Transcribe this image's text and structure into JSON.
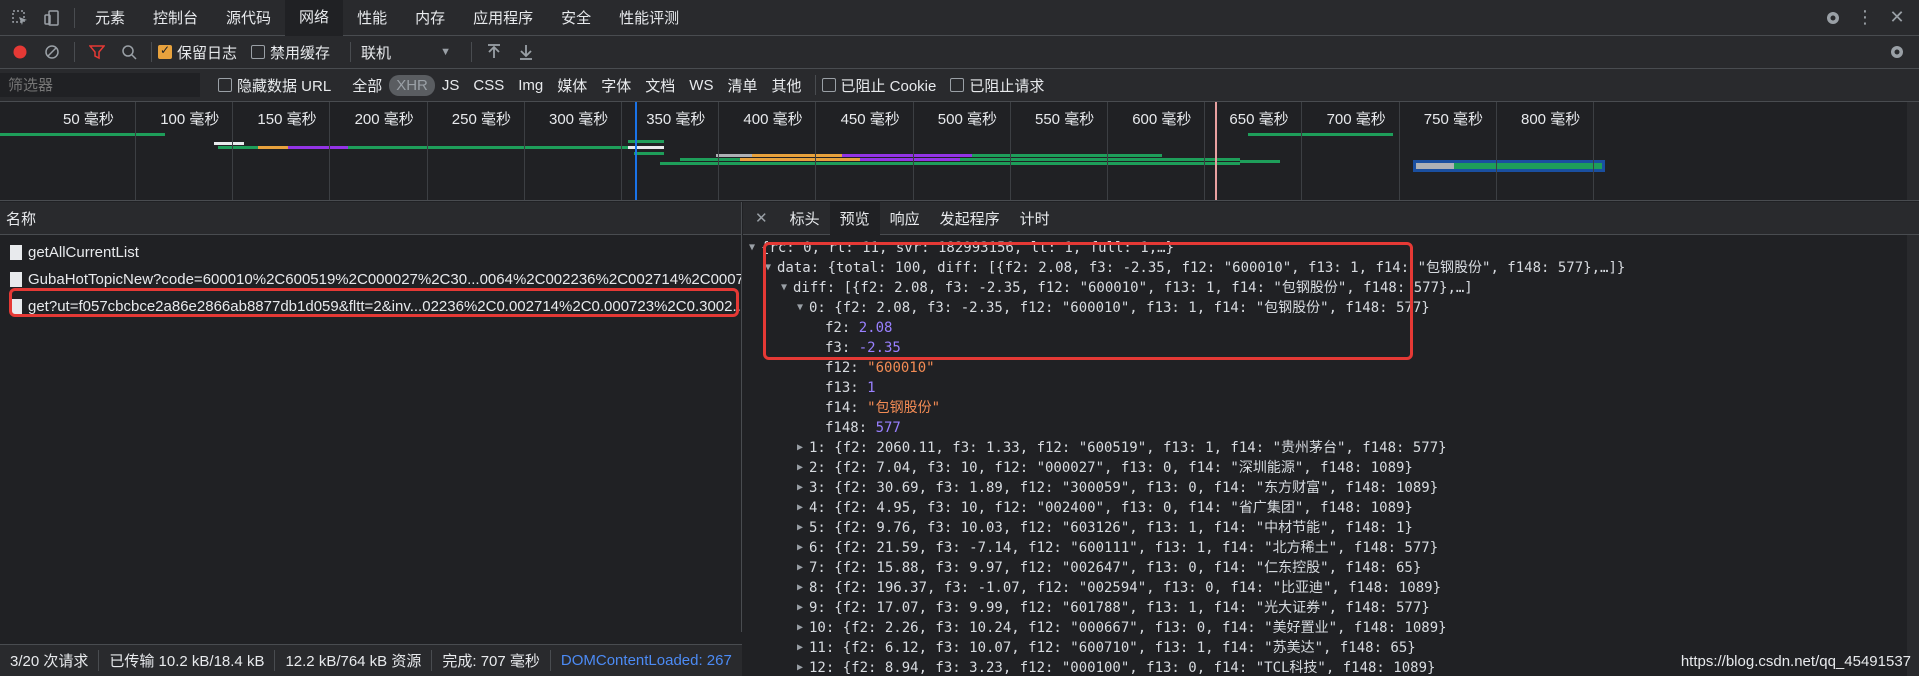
{
  "main_tabs": [
    "元素",
    "控制台",
    "源代码",
    "网络",
    "性能",
    "内存",
    "应用程序",
    "安全",
    "性能评测"
  ],
  "active_main_tab": "网络",
  "toolbar": {
    "preserve_log": "保留日志",
    "disable_cache": "禁用缓存",
    "throttle": "联机"
  },
  "filterbar": {
    "filter_placeholder": "筛选器",
    "hide_data_url": "隐藏数据 URL",
    "types": [
      "全部",
      "XHR",
      "JS",
      "CSS",
      "Img",
      "媒体",
      "字体",
      "文档",
      "WS",
      "清单",
      "其他"
    ],
    "blocked_cookies": "已阻止 Cookie",
    "blocked_requests": "已阻止请求"
  },
  "timeline": {
    "ticks": [
      "50 毫秒",
      "100 毫秒",
      "150 毫秒",
      "200 毫秒",
      "250 毫秒",
      "300 毫秒",
      "350 毫秒",
      "400 毫秒",
      "450 毫秒",
      "500 毫秒",
      "550 毫秒",
      "600 毫秒",
      "650 毫秒",
      "700 毫秒",
      "750 毫秒",
      "800 毫秒"
    ]
  },
  "requests": {
    "header": "名称",
    "rows": [
      "getAllCurrentList",
      "GubaHotTopicNew?code=600010%2C600519%2C000027%2C30...0064%2C002236%2C002714%2C0007...",
      "get?ut=f057cbcbce2a86e2866ab8877db1d059&fltt=2&inv...02236%2C0.002714%2C0.000723%2C0.3002..."
    ]
  },
  "detail_tabs": [
    "标头",
    "预览",
    "响应",
    "发起程序",
    "计时"
  ],
  "active_detail_tab": "预览",
  "preview": {
    "root": "{rc: 0, rt: 11, svr: 182993156, lt: 1, full: 1,…}",
    "data": "data: {total: 100, diff: [{f2: 2.08, f3: -2.35, f12: \"600010\", f13: 1, f14: \"包钢股份\", f148: 577},…]}",
    "diff": "diff: [{f2: 2.08, f3: -2.35, f12: \"600010\", f13: 1, f14: \"包钢股份\", f148: 577},…]",
    "item0": "0: {f2: 2.08, f3: -2.35, f12: \"600010\", f13: 1, f14: \"包钢股份\", f148: 577}",
    "fields": [
      {
        "k": "f2",
        "v": "2.08",
        "t": "num"
      },
      {
        "k": "f3",
        "v": "-2.35",
        "t": "num"
      },
      {
        "k": "f12",
        "v": "\"600010\"",
        "t": "str"
      },
      {
        "k": "f13",
        "v": "1",
        "t": "num"
      },
      {
        "k": "f14",
        "v": "\"包钢股份\"",
        "t": "str"
      },
      {
        "k": "f148",
        "v": "577",
        "t": "num"
      }
    ],
    "items": [
      "1: {f2: 2060.11, f3: 1.33, f12: \"600519\", f13: 1, f14: \"贵州茅台\", f148: 577}",
      "2: {f2: 7.04, f3: 10, f12: \"000027\", f13: 0, f14: \"深圳能源\", f148: 1089}",
      "3: {f2: 30.69, f3: 1.89, f12: \"300059\", f13: 0, f14: \"东方财富\", f148: 1089}",
      "4: {f2: 4.95, f3: 10, f12: \"002400\", f13: 0, f14: \"省广集团\", f148: 1089}",
      "5: {f2: 9.76, f3: 10.03, f12: \"603126\", f13: 1, f14: \"中材节能\", f148: 1}",
      "6: {f2: 21.59, f3: -7.14, f12: \"600111\", f13: 1, f14: \"北方稀土\", f148: 577}",
      "7: {f2: 15.88, f3: 9.97, f12: \"002647\", f13: 0, f14: \"仁东控股\", f148: 65}",
      "8: {f2: 196.37, f3: -1.07, f12: \"002594\", f13: 0, f14: \"比亚迪\", f148: 1089}",
      "9: {f2: 17.07, f3: 9.99, f12: \"601788\", f13: 1, f14: \"光大证券\", f148: 577}",
      "10: {f2: 2.26, f3: 10.24, f12: \"000667\", f13: 0, f14: \"美好置业\", f148: 1089}",
      "11: {f2: 6.12, f3: 10.07, f12: \"600710\", f13: 1, f14: \"苏美达\", f148: 65}",
      "12: {f2: 8.94, f3: 3.23, f12: \"000100\", f13: 0, f14: \"TCL科技\", f148: 1089}"
    ]
  },
  "status": {
    "requests": "3/20 次请求",
    "transferred": "已传输 10.2 kB/18.4 kB",
    "resources": "12.2 kB/764 kB 资源",
    "finish": "完成: 707 毫秒",
    "dcl": "DOMContentLoaded: 267"
  },
  "watermark": "https://blog.csdn.net/qq_45491537"
}
